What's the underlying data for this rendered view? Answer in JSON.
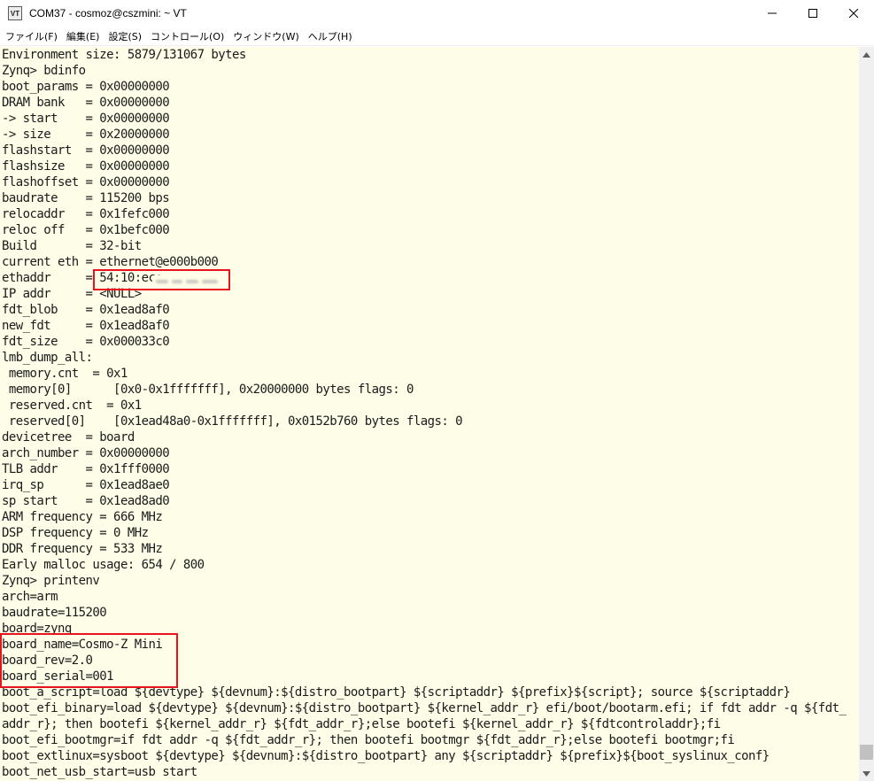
{
  "window": {
    "icon_text": "VT",
    "title": "COM37 - cosmoz@cszmini: ~ VT"
  },
  "menu": {
    "items": [
      "ファイル(F)",
      "編集(E)",
      "設定(S)",
      "コントロール(O)",
      "ウィンドウ(W)",
      "ヘルプ(H)"
    ]
  },
  "terminal": {
    "lines": [
      "Environment size: 5879/131067 bytes",
      "Zynq> bdinfo",
      "boot_params = 0x00000000",
      "DRAM bank   = 0x00000000",
      "-> start    = 0x00000000",
      "-> size     = 0x20000000",
      "flashstart  = 0x00000000",
      "flashsize   = 0x00000000",
      "flashoffset = 0x00000000",
      "baudrate    = 115200 bps",
      "relocaddr   = 0x1fefc000",
      "reloc off   = 0x1befc000",
      "Build       = 32-bit",
      "current eth = ethernet@e000b000",
      "ethaddr     = 54:10:ec:",
      "IP addr     = <NULL>",
      "fdt_blob    = 0x1ead8af0",
      "new_fdt     = 0x1ead8af0",
      "fdt_size    = 0x000033c0",
      "lmb_dump_all:",
      " memory.cnt  = 0x1",
      " memory[0]      [0x0-0x1fffffff], 0x20000000 bytes flags: 0",
      " reserved.cnt  = 0x1",
      " reserved[0]    [0x1ead48a0-0x1fffffff], 0x0152b760 bytes flags: 0",
      "devicetree  = board",
      "arch_number = 0x00000000",
      "TLB addr    = 0x1fff0000",
      "irq_sp      = 0x1ead8ae0",
      "sp start    = 0x1ead8ad0",
      "ARM frequency = 666 MHz",
      "DSP frequency = 0 MHz",
      "DDR frequency = 533 MHz",
      "Early malloc usage: 654 / 800",
      "Zynq> printenv",
      "arch=arm",
      "baudrate=115200",
      "board=zynq",
      "board_name=Cosmo-Z Mini",
      "board_rev=2.0",
      "board_serial=001",
      "boot_a_script=load ${devtype} ${devnum}:${distro_bootpart} ${scriptaddr} ${prefix}${script}; source ${scriptaddr}",
      "boot_efi_binary=load ${devtype} ${devnum}:${distro_bootpart} ${kernel_addr_r} efi/boot/bootarm.efi; if fdt addr -q ${fdt_",
      "addr_r}; then bootefi ${kernel_addr_r} ${fdt_addr_r};else bootefi ${kernel_addr_r} ${fdtcontroladdr};fi",
      "boot_efi_bootmgr=if fdt addr -q ${fdt_addr_r}; then bootefi bootmgr ${fdt_addr_r};else bootefi bootmgr;fi",
      "boot_extlinux=sysboot ${devtype} ${devnum}:${distro_bootpart} any ${scriptaddr} ${prefix}${boot_syslinux_conf}",
      "boot_net_usb_start=usb start"
    ]
  },
  "colors": {
    "terminal_background": "#fefee8",
    "terminal_text": "#1a1a1a",
    "highlight_border": "#e8141c"
  }
}
